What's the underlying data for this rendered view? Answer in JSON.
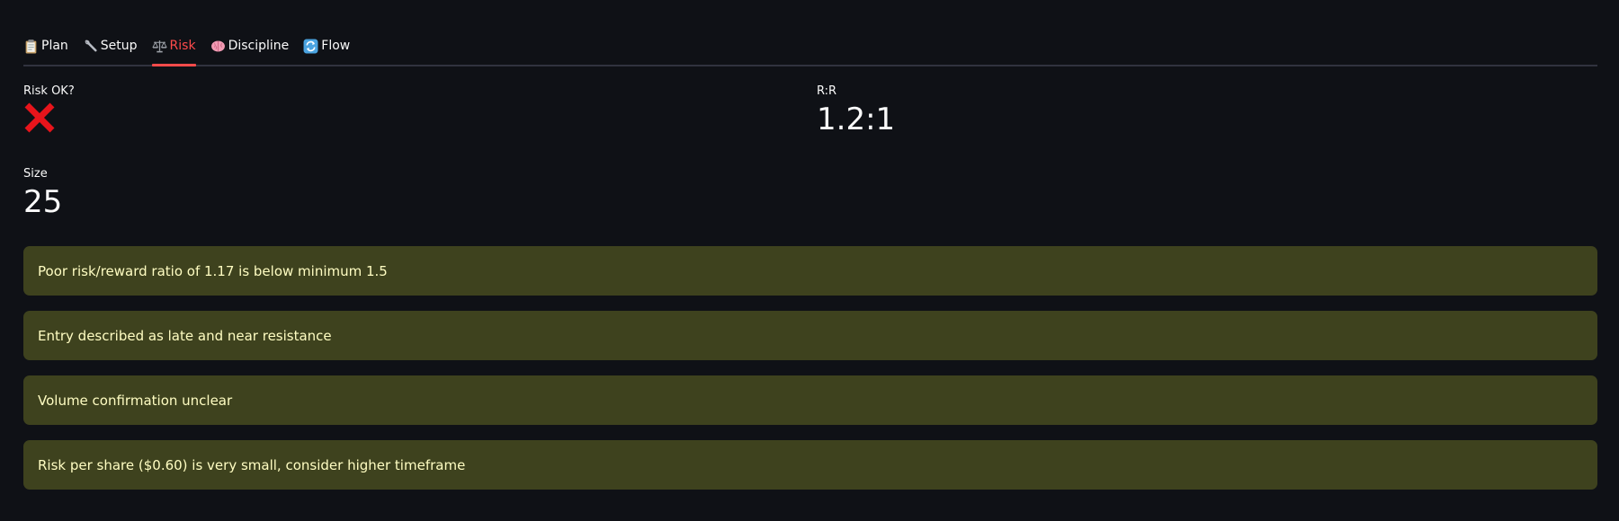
{
  "tabs": [
    {
      "label": "Plan",
      "icon": "clipboard-icon",
      "active": false
    },
    {
      "label": "Setup",
      "icon": "wrench-icon",
      "active": false
    },
    {
      "label": "Risk",
      "icon": "balance-scale-icon",
      "active": true
    },
    {
      "label": "Discipline",
      "icon": "brain-icon",
      "active": false
    },
    {
      "label": "Flow",
      "icon": "refresh-icon",
      "active": false
    }
  ],
  "metrics": {
    "risk_ok": {
      "label": "Risk OK?",
      "value_icon": "cross-mark-icon"
    },
    "rr": {
      "label": "R:R",
      "value": "1.2:1"
    },
    "size": {
      "label": "Size",
      "value": "25"
    }
  },
  "alerts": [
    "Poor risk/reward ratio of 1.17 is below minimum 1.5",
    "Entry described as late and near resistance",
    "Volume confirmation unclear",
    "Risk per share ($0.60) is very small, consider higher timeframe"
  ],
  "colors": {
    "background": "#0f1116",
    "accent": "#ff4b4b",
    "warning_bg": "#3e421e",
    "warning_text": "#fffdc2",
    "cross": "#e8141b"
  }
}
